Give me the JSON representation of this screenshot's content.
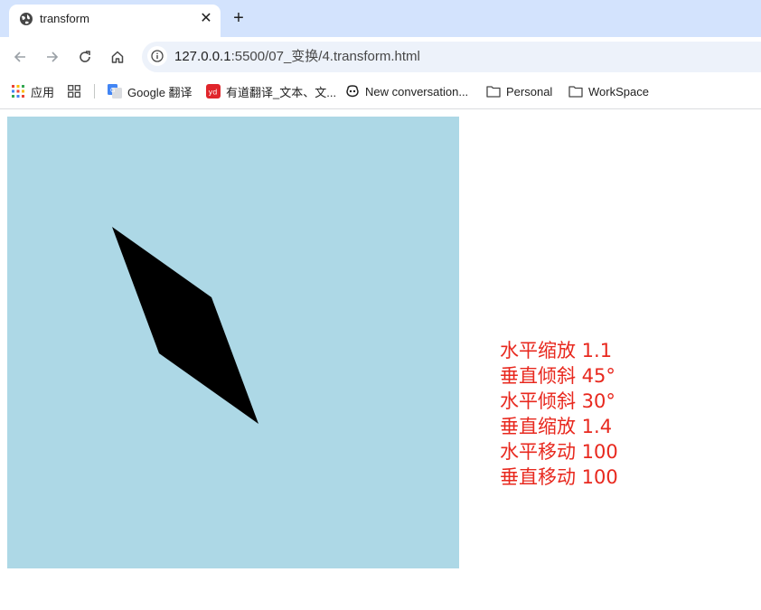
{
  "browser": {
    "tab": {
      "title": "transform",
      "close_glyph": "✕"
    },
    "new_tab_glyph": "+",
    "address": {
      "host": "127.0.0.1",
      "path": ":5500/07_变换/4.transform.html"
    },
    "bookmarks": [
      {
        "label": "应用",
        "icon": "apps-grid-icon"
      },
      {
        "label": "",
        "icon": "tab-groups-icon"
      },
      {
        "label": "Google 翻译",
        "icon": "google-translate-icon"
      },
      {
        "label": "有道翻译_文本、文...",
        "icon": "youdao-icon"
      },
      {
        "label": "New conversation...",
        "icon": "copilot-icon"
      },
      {
        "label": "Personal",
        "icon": "folder-icon"
      },
      {
        "label": "WorkSpace",
        "icon": "folder-icon"
      }
    ]
  },
  "page": {
    "stage_color": "#add8e6",
    "shape_color": "#000000",
    "label_color": "#e8281e",
    "labels": [
      "水平缩放 1.1",
      "垂直倾斜 45°",
      "水平倾斜 30°",
      "垂直缩放 1.4",
      "水平移动 100",
      "垂直移动 100"
    ]
  }
}
